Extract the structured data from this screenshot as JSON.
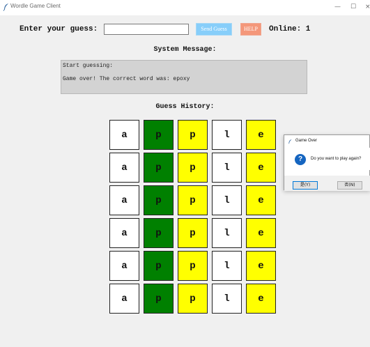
{
  "window": {
    "title": "Wordle Game Client",
    "minimize_glyph": "—",
    "maximize_glyph": "☐",
    "close_glyph": "×"
  },
  "input_row": {
    "label": "Enter your guess:",
    "guess_value": "",
    "guess_placeholder": "",
    "send_label": "Send Guess",
    "help_label": "HELP",
    "online_text": "Online: 1"
  },
  "system_message": {
    "title": "System Message:",
    "lines": [
      "Start guessing:",
      "Game over! The correct word was: epoxy"
    ]
  },
  "history": {
    "title": "Guess History:",
    "rows": [
      [
        "a",
        "p",
        "p",
        "l",
        "e"
      ],
      [
        "a",
        "p",
        "p",
        "l",
        "e"
      ],
      [
        "a",
        "p",
        "p",
        "l",
        "e"
      ],
      [
        "a",
        "p",
        "p",
        "l",
        "e"
      ],
      [
        "a",
        "p",
        "p",
        "l",
        "e"
      ],
      [
        "a",
        "p",
        "p",
        "l",
        "e"
      ]
    ],
    "states": [
      "absent",
      "correct",
      "present",
      "absent",
      "present"
    ],
    "state_colors": {
      "correct": "#008000",
      "present": "#ffff00",
      "absent": "#ffffff"
    }
  },
  "dialog": {
    "title": "Game Over",
    "icon": "question-icon",
    "message": "Do you want to play again?",
    "yes_label": "是(Y)",
    "no_label": "否(N)"
  },
  "colors": {
    "send_button": "#87cefa",
    "help_button": "#f4977a",
    "message_box": "#d3d3d3"
  }
}
